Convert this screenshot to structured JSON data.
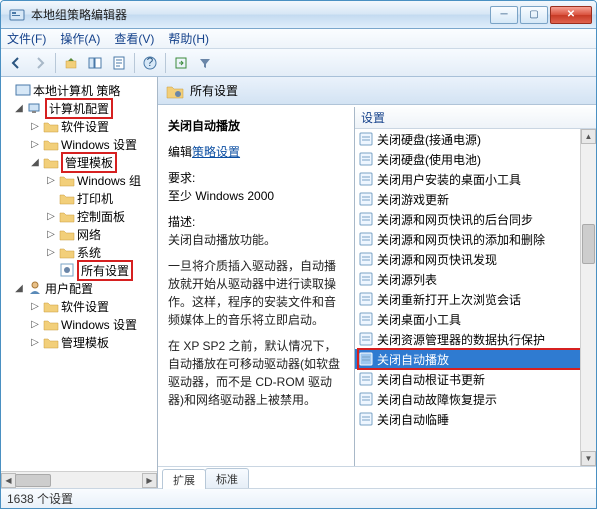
{
  "window": {
    "title": "本地组策略编辑器"
  },
  "menu": {
    "file": "文件(F)",
    "action": "操作(A)",
    "view": "查看(V)",
    "help": "帮助(H)"
  },
  "tree": {
    "root": "本地计算机 策略",
    "computer_config": "计算机配置",
    "software_settings": "软件设置",
    "windows_settings": "Windows 设置",
    "admin_templates": "管理模板",
    "windows_group": "Windows 组",
    "printers": "打印机",
    "control_panel": "控制面板",
    "network": "网络",
    "system": "系统",
    "all_settings": "所有设置",
    "user_config": "用户配置",
    "u_software": "软件设置",
    "u_windows": "Windows 设置",
    "u_admin": "管理模板"
  },
  "right": {
    "header": "所有设置",
    "setting_title": "关闭自动播放",
    "edit_label_prefix": "编辑",
    "edit_link": "策略设置",
    "req_label": "要求:",
    "req_value": "至少 Windows 2000",
    "desc_label": "描述:",
    "desc_1": "关闭自动播放功能。",
    "desc_2": "一旦将介质插入驱动器，自动播放就开始从驱动器中进行读取操作。这样，程序的安装文件和音频媒体上的音乐将立即启动。",
    "desc_3": "在 XP SP2 之前，默认情况下，自动播放在可移动驱动器(如软盘驱动器，而不是 CD-ROM 驱动器)和网络驱动器上被禁用。",
    "list_header": "设置",
    "items": [
      "关闭硬盘(接通电源)",
      "关闭硬盘(使用电池)",
      "关闭用户安装的桌面小工具",
      "关闭游戏更新",
      "关闭源和网页快讯的后台同步",
      "关闭源和网页快讯的添加和删除",
      "关闭源和网页快讯发现",
      "关闭源列表",
      "关闭重新打开上次浏览会话",
      "关闭桌面小工具",
      "关闭资源管理器的数据执行保护",
      "关闭自动播放",
      "关闭自动根证书更新",
      "关闭自动故障恢复提示",
      "关闭自动临睡"
    ],
    "selected_index": 11
  },
  "tabs": {
    "extended": "扩展",
    "standard": "标准"
  },
  "status": "1638 个设置"
}
